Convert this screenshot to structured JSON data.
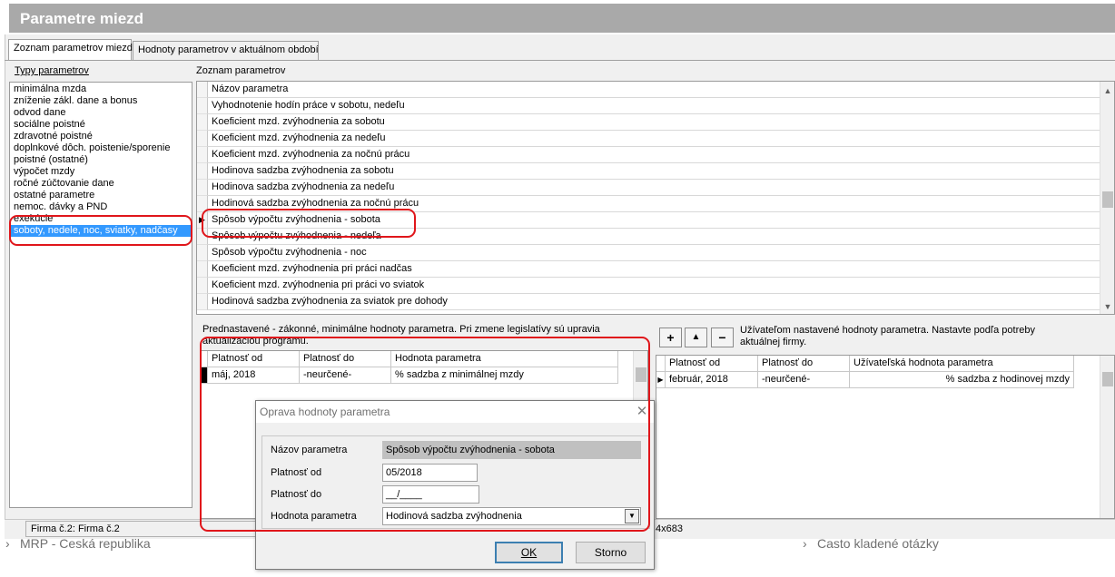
{
  "window": {
    "title": "Parametre miezd"
  },
  "tabs": [
    {
      "label": "Zoznam parametrov miezd",
      "active": true
    },
    {
      "label": "Hodnoty parametrov v aktuálnom období",
      "active": false
    }
  ],
  "left_panel": {
    "label": "Typy parametrov",
    "items": [
      "minimálna mzda",
      "zníženie zákl. dane a bonus",
      "odvod dane",
      "sociálne poistné",
      "zdravotné poistné",
      "doplnkové dôch. poistenie/sporenie",
      "poistné (ostatné)",
      "výpočet mzdy",
      "ročné zúčtovanie dane",
      "ostatné parametre",
      "nemoc. dávky a PND",
      "exekúcie",
      "soboty, nedele, noc, sviatky, nadčasy"
    ],
    "selected_index": 12
  },
  "params_panel": {
    "label": "Zoznam parametrov",
    "column_header": "Názov parametra",
    "rows": [
      "Vyhodnotenie hodín práce v sobotu, nedeľu",
      "Koeficient mzd. zvýhodnenia za sobotu",
      "Koeficient mzd. zvýhodnenia za nedeľu",
      "Koeficient mzd. zvýhodnenia za nočnú prácu",
      "Hodinova sadzba zvýhodnenia za sobotu",
      "Hodinova sadzba zvýhodnenia za nedeľu",
      "Hodinová sadzba zvýhodnenia za nočnú prácu",
      "Spôsob výpočtu zvýhodnenia - sobota",
      "Spôsob výpočtu zvýhodnenia - nedeľa",
      "Spôsob výpočtu zvýhodnenia - noc",
      "Koeficient mzd. zvýhodnenia pri práci nadčas",
      "Koeficient mzd. zvýhodnenia pri práci vo sviatok",
      "Hodinová sadzba zvýhodnenia za sviatok pre dohody"
    ],
    "current_row_index": 7
  },
  "defaults_panel": {
    "note": "Prednastavené - zákonné, minimálne hodnoty parametra. Pri zmene legislatívy sú upravia aktualizáciou programu.",
    "columns": [
      "Platnosť od",
      "Platnosť do",
      "Hodnota parametra"
    ],
    "rows": [
      [
        "máj, 2018",
        "-neurčené-",
        "% sadzba z minimálnej mzdy"
      ]
    ]
  },
  "user_panel": {
    "buttons": {
      "add": "+",
      "up": "▲",
      "remove": "−"
    },
    "note": "Užívateľom nastavené hodnoty parametra. Nastavte podľa potreby aktuálnej firmy.",
    "columns": [
      "Platnosť od",
      "Platnosť do",
      "Užívateľská hodnota parametra"
    ],
    "rows": [
      [
        "február, 2018",
        "-neurčené-",
        "% sadzba z hodinovej mzdy"
      ]
    ]
  },
  "status_bar": {
    "firm": "Firma č.2: Firma č.2",
    "resolution": "4x683"
  },
  "background_page": {
    "left_link": "MRP - Česká republika",
    "right_link": "Často kladené otázky"
  },
  "dialog": {
    "title": "Oprava hodnoty parametra",
    "fields": {
      "name": {
        "label": "Názov parametra",
        "value": "Spôsob výpočtu zvýhodnenia - sobota"
      },
      "valid_from": {
        "label": "Platnosť od",
        "value": "05/2018"
      },
      "valid_to": {
        "label": "Platnosť do",
        "value": "__/____"
      },
      "value": {
        "label": "Hodnota parametra",
        "value": "Hodinová sadzba zvýhodnenia"
      }
    },
    "ok_label": "OK",
    "cancel_label": "Storno"
  }
}
